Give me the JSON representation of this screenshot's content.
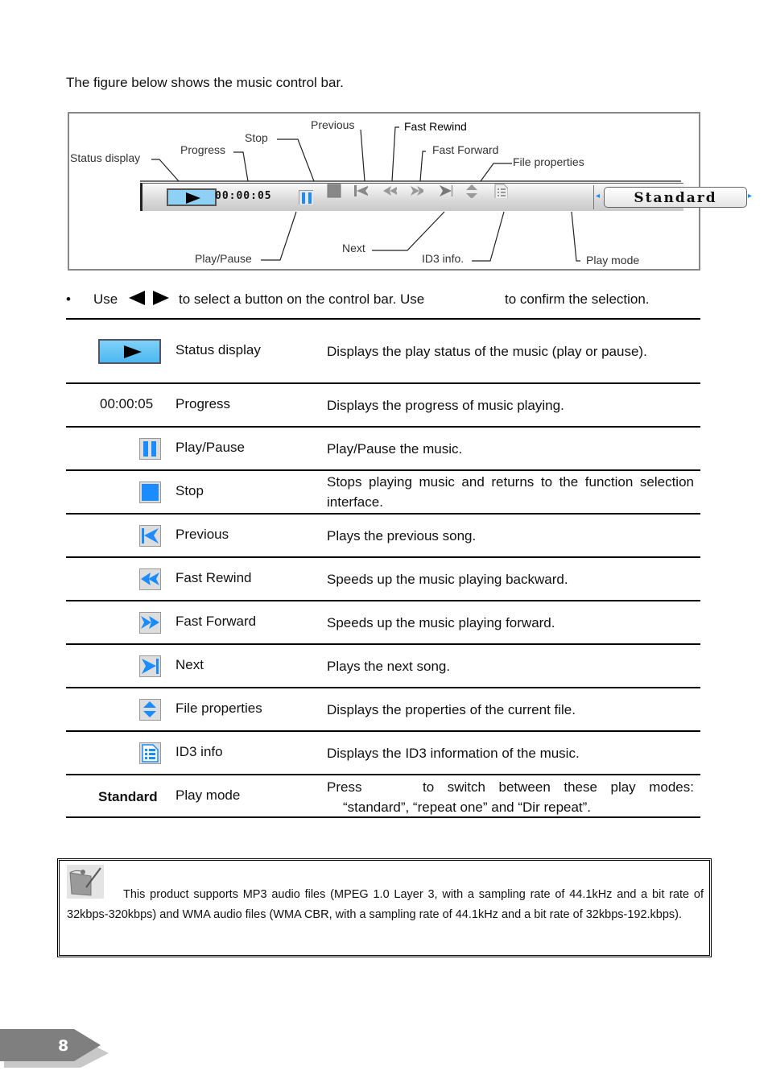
{
  "intro": "The figure below shows the music control bar.",
  "figure": {
    "callouts": {
      "status_display": "Status display",
      "progress": "Progress",
      "stop": "Stop",
      "previous": "Previous",
      "fast_rewind": "Fast Rewind",
      "fast_forward": "Fast Forward",
      "file_properties": "File properties",
      "play_pause": "Play/Pause",
      "next": "Next",
      "id3_info": "ID3 info.",
      "play_mode": "Play mode"
    },
    "control_bar": {
      "time": "00:00:05",
      "mode": "Standard"
    }
  },
  "bullet": {
    "part1": "Use",
    "part2": "to select a button on the control bar. Use",
    "part3": "to confirm the selection."
  },
  "table": [
    {
      "icon": "status-display-icon",
      "name": "Status display",
      "desc": "Displays the play status of the music (play or pause)."
    },
    {
      "icon_text": "00:00:05",
      "name": "Progress",
      "desc": "Displays the progress of music playing."
    },
    {
      "icon": "pause-icon",
      "name": "Play/Pause",
      "desc": "Play/Pause the music."
    },
    {
      "icon": "stop-icon",
      "name": "Stop",
      "desc": "Stops playing music and returns to the function selection interface."
    },
    {
      "icon": "previous-icon",
      "name": "Previous",
      "desc": "Plays the previous song."
    },
    {
      "icon": "fast-rewind-icon",
      "name": "Fast Rewind",
      "desc": "Speeds up the music playing backward."
    },
    {
      "icon": "fast-forward-icon",
      "name": "Fast Forward",
      "desc": "Speeds up the music playing forward."
    },
    {
      "icon": "next-icon",
      "name": "Next",
      "desc": "Plays the next song."
    },
    {
      "icon": "file-properties-icon",
      "name": "File properties",
      "desc": "Displays the properties of the current file."
    },
    {
      "icon": "id3-info-icon",
      "name": "ID3 info",
      "desc": "Displays the ID3 information of the music."
    },
    {
      "icon_text": "Standard",
      "name": "Play mode",
      "desc_line1": "Press            to switch between these play modes:",
      "desc_line2": "“standard”, “repeat one” and “Dir repeat”."
    }
  ],
  "note": "This product supports MP3 audio files (MPEG 1.0 Layer 3, with a sampling rate of 44.1kHz and a bit rate of 32kbps-320kbps) and WMA audio files (WMA CBR, with a sampling rate of 44.1kHz and a bit rate of 32kbps-192.kbps).",
  "page_number": "8",
  "colors": {
    "accent_blue": "#1a8cff",
    "status_blue": "#8fd0f5",
    "page_tab": "#7f7f7f"
  }
}
